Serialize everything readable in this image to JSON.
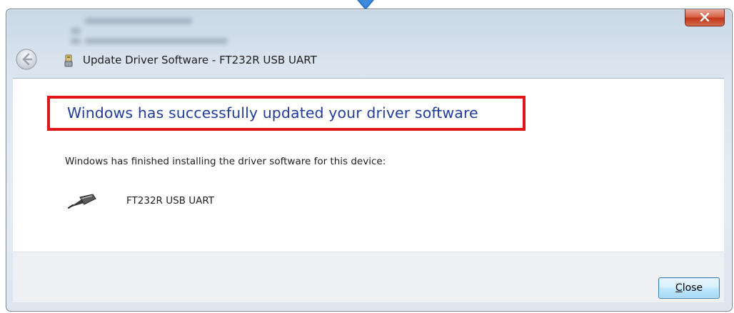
{
  "window": {
    "title": "Update Driver Software - FT232R USB UART",
    "close_glyph": "x"
  },
  "content": {
    "headline": "Windows has successfully updated your driver software",
    "message": "Windows has finished installing the driver software for this device:",
    "device_name": "FT232R USB UART"
  },
  "footer": {
    "close_button": {
      "mnemonic": "C",
      "rest": "lose"
    }
  },
  "icons": {
    "back": "back-arrow-icon",
    "title": "usb-driver-icon",
    "device": "usb-plug-icon",
    "window_close": "close-icon"
  },
  "colors": {
    "headline": "#1f3d99",
    "highlight_box": "#e01616",
    "close_button_red": "#c2371a",
    "button_border": "#3c7fb1"
  }
}
